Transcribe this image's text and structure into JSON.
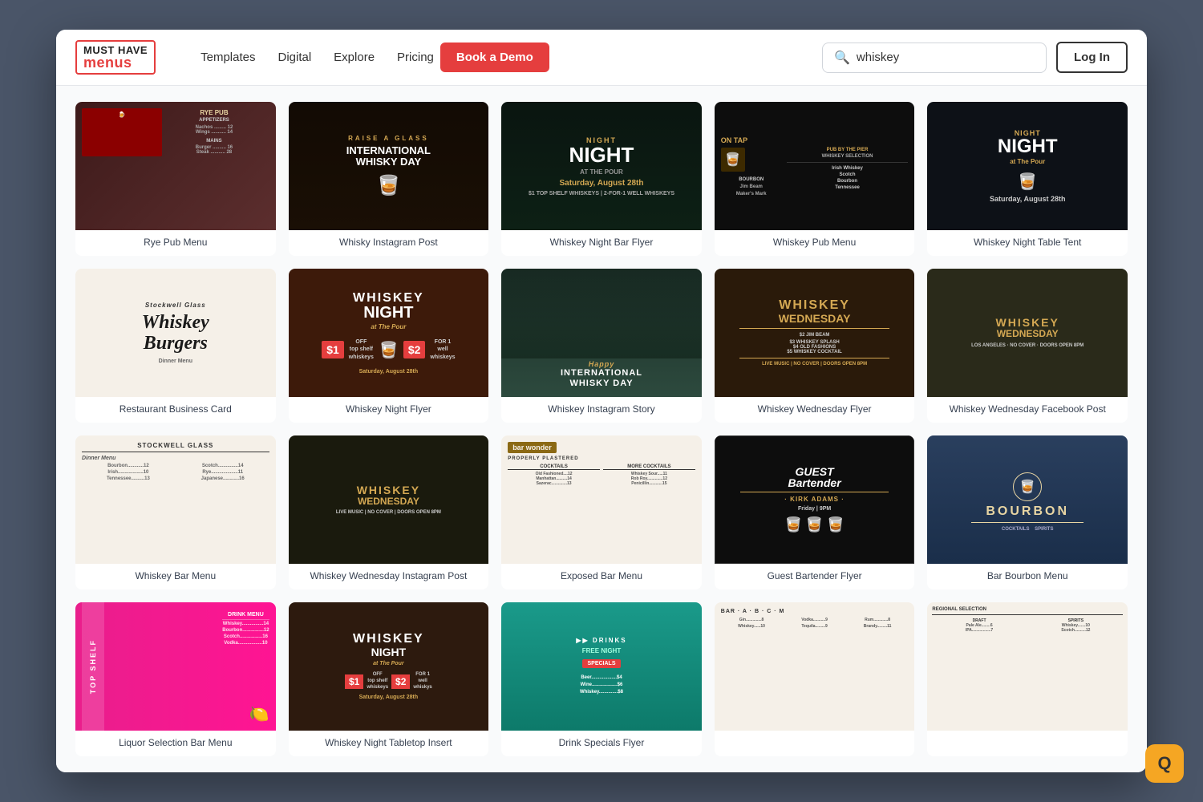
{
  "header": {
    "logo": {
      "line1": "MUST HAVE",
      "line2": "menus"
    },
    "nav": {
      "items": [
        "Templates",
        "Digital",
        "Explore",
        "Pricing"
      ]
    },
    "book_demo": "Book a Demo",
    "search": {
      "placeholder": "whiskey",
      "value": "whiskey"
    },
    "login": "Log In"
  },
  "grid": {
    "cards": [
      {
        "id": 1,
        "label": "Rye Pub Menu",
        "style": "rye-pub"
      },
      {
        "id": 2,
        "label": "Whisky Instagram Post",
        "style": "whisky-insta"
      },
      {
        "id": 3,
        "label": "Whiskey Night Bar Flyer",
        "style": "night-bar"
      },
      {
        "id": 4,
        "label": "Whiskey Pub Menu",
        "style": "pub-menu"
      },
      {
        "id": 5,
        "label": "Whiskey Night Table Tent",
        "style": "night-table"
      },
      {
        "id": 6,
        "label": "Restaurant Business Card",
        "style": "biz-card"
      },
      {
        "id": 7,
        "label": "Whiskey Night Flyer",
        "style": "night-flyer"
      },
      {
        "id": 8,
        "label": "Whiskey Instagram Story",
        "style": "insta-story"
      },
      {
        "id": 9,
        "label": "Whiskey Wednesday Flyer",
        "style": "wed-flyer"
      },
      {
        "id": 10,
        "label": "Whiskey Wednesday Facebook Post",
        "style": "wed-facebook"
      },
      {
        "id": 11,
        "label": "Whiskey Bar Menu",
        "style": "bar-menu"
      },
      {
        "id": 12,
        "label": "Whiskey Wednesday Instagram Post",
        "style": "wed-insta"
      },
      {
        "id": 13,
        "label": "Exposed Bar Menu",
        "style": "exposed-bar"
      },
      {
        "id": 14,
        "label": "Guest Bartender Flyer",
        "style": "guest-bartender"
      },
      {
        "id": 15,
        "label": "Bar Bourbon Menu",
        "style": "bourbon-menu"
      },
      {
        "id": 16,
        "label": "Liquor Selection Bar Menu",
        "style": "liquor-menu"
      },
      {
        "id": 17,
        "label": "Whiskey Night Tabletop Insert",
        "style": "tabletop"
      },
      {
        "id": 18,
        "label": "Drink Specials Flyer",
        "style": "drink-specials"
      },
      {
        "id": 19,
        "label": "",
        "style": "empty"
      },
      {
        "id": 20,
        "label": "",
        "style": "empty2"
      }
    ]
  },
  "bottom_logo": "Q"
}
